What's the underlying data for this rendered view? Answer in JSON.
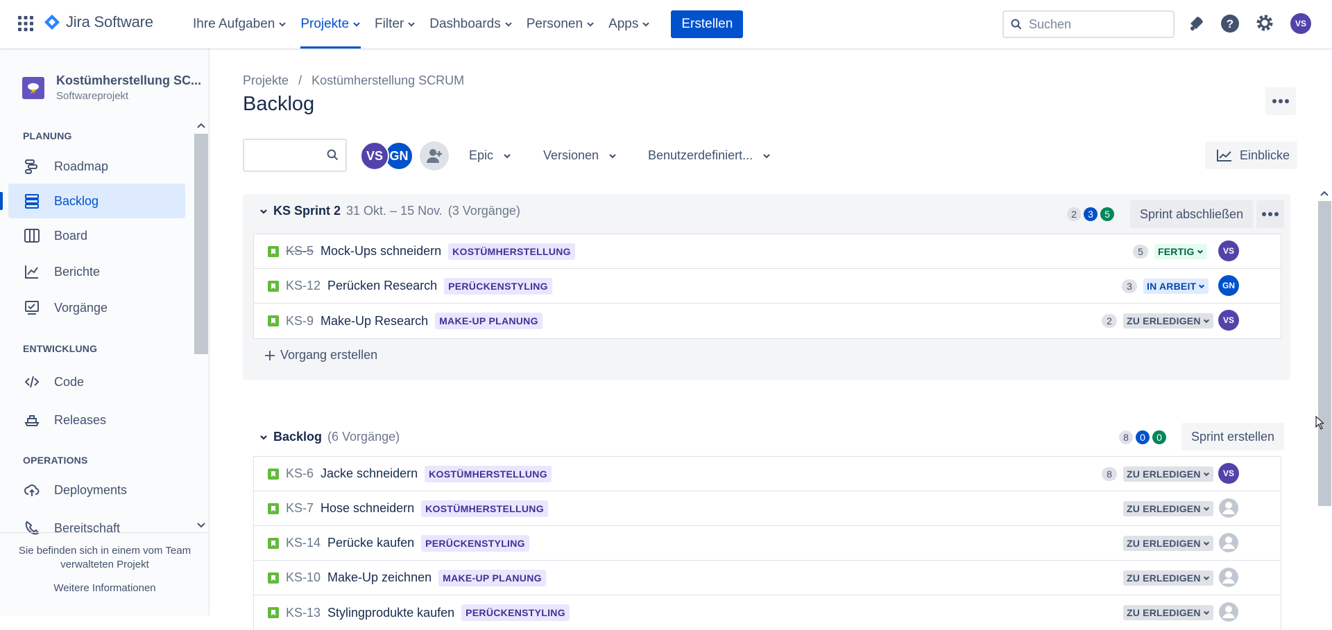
{
  "topbar": {
    "product": "Jira Software",
    "nav": [
      {
        "label": "Ihre Aufgaben",
        "active": false
      },
      {
        "label": "Projekte",
        "active": true
      },
      {
        "label": "Filter",
        "active": false
      },
      {
        "label": "Dashboards",
        "active": false
      },
      {
        "label": "Personen",
        "active": false
      },
      {
        "label": "Apps",
        "active": false
      }
    ],
    "create_label": "Erstellen",
    "search_placeholder": "Suchen",
    "user_initials": "VS"
  },
  "sidebar": {
    "project_name": "Kostümherstellung SC...",
    "project_type": "Softwareprojekt",
    "sections": {
      "planning": "PLANUNG",
      "development": "ENTWICKLUNG",
      "operations": "OPERATIONS"
    },
    "items": [
      {
        "label": "Roadmap",
        "icon": "roadmap-icon"
      },
      {
        "label": "Backlog",
        "icon": "backlog-icon",
        "active": true
      },
      {
        "label": "Board",
        "icon": "board-icon"
      },
      {
        "label": "Berichte",
        "icon": "reports-icon"
      },
      {
        "label": "Vorgänge",
        "icon": "issues-icon"
      },
      {
        "label": "Code",
        "icon": "code-icon"
      },
      {
        "label": "Releases",
        "icon": "releases-icon"
      },
      {
        "label": "Deployments",
        "icon": "deployments-icon"
      },
      {
        "label": "Bereitschaft",
        "icon": "oncall-icon"
      }
    ],
    "footer_text": "Sie befinden sich in einem vom Team verwalteten Projekt",
    "footer_link": "Weitere Informationen"
  },
  "main": {
    "breadcrumb": {
      "root": "Projekte",
      "sep": "/",
      "project": "Kostümherstellung SCRUM"
    },
    "title": "Backlog",
    "filters": {
      "avatars": [
        "VS",
        "GN"
      ],
      "epic": "Epic",
      "versions": "Versionen",
      "custom": "Benutzerdefiniert...",
      "insights": "Einblicke"
    }
  },
  "sprint": {
    "name": "KS Sprint 2",
    "dates": "31 Okt. – 15 Nov.",
    "count": "(3 Vorgänge)",
    "counts": [
      "2",
      "3",
      "5"
    ],
    "complete_label": "Sprint abschließen",
    "create_issue": "Vorgang erstellen",
    "issues": [
      {
        "key": "KS-5",
        "summary": "Mock-Ups schneidern",
        "epic": "KOSTÜMHERSTELLUNG",
        "estimate": "5",
        "status": "FERTIG",
        "assignee": "VS",
        "done": true
      },
      {
        "key": "KS-12",
        "summary": "Perücken Research",
        "epic": "PERÜCKENSTYLING",
        "estimate": "3",
        "status": "IN ARBEIT",
        "assignee": "GN"
      },
      {
        "key": "KS-9",
        "summary": "Make-Up Research",
        "epic": "MAKE-UP PLANUNG",
        "estimate": "2",
        "status": "ZU ERLEDIGEN",
        "assignee": "VS"
      }
    ]
  },
  "backlog": {
    "name": "Backlog",
    "count": "(6 Vorgänge)",
    "counts": [
      "8",
      "0",
      "0"
    ],
    "create_sprint_label": "Sprint erstellen",
    "issues": [
      {
        "key": "KS-6",
        "summary": "Jacke schneidern",
        "epic": "KOSTÜMHERSTELLUNG",
        "estimate": "8",
        "status": "ZU ERLEDIGEN",
        "assignee": "VS"
      },
      {
        "key": "KS-7",
        "summary": "Hose schneidern",
        "epic": "KOSTÜMHERSTELLUNG",
        "estimate": "",
        "status": "ZU ERLEDIGEN",
        "assignee": ""
      },
      {
        "key": "KS-14",
        "summary": "Perücke kaufen",
        "epic": "PERÜCKENSTYLING",
        "estimate": "",
        "status": "ZU ERLEDIGEN",
        "assignee": ""
      },
      {
        "key": "KS-10",
        "summary": "Make-Up zeichnen",
        "epic": "MAKE-UP PLANUNG",
        "estimate": "",
        "status": "ZU ERLEDIGEN",
        "assignee": ""
      },
      {
        "key": "KS-13",
        "summary": "Stylingprodukte kaufen",
        "epic": "PERÜCKENSTYLING",
        "estimate": "",
        "status": "ZU ERLEDIGEN",
        "assignee": ""
      }
    ]
  },
  "colors": {
    "primary": "#0052cc",
    "avatar_vs": "#5243aa",
    "avatar_gn": "#0052cc",
    "story": "#63ba3c",
    "done": "#00875a"
  }
}
